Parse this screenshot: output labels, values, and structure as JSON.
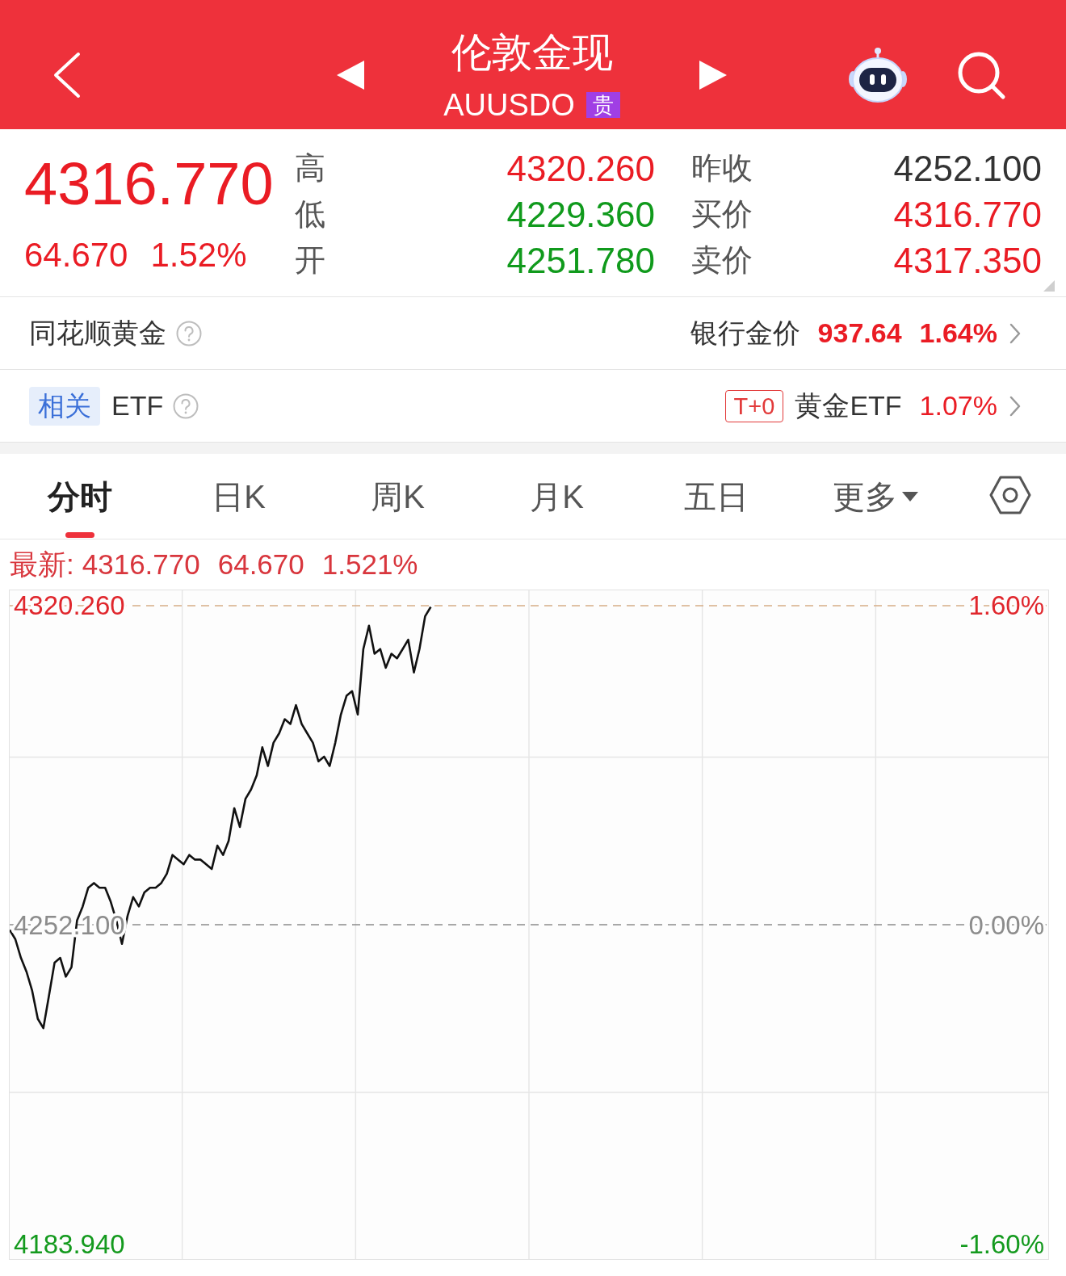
{
  "header": {
    "title": "伦敦金现",
    "code": "AUUSDO",
    "badge": "贵"
  },
  "quote": {
    "price": "4316.770",
    "change": "64.670",
    "percent": "1.52%",
    "color": "#ea1c24",
    "stats": [
      {
        "label": "高",
        "value": "4320.260",
        "color": "#ea1c24"
      },
      {
        "label": "低",
        "value": "4229.360",
        "color": "#109a1c"
      },
      {
        "label": "开",
        "value": "4251.780",
        "color": "#109a1c"
      }
    ],
    "stats_right": [
      {
        "label": "昨收",
        "value": "4252.100",
        "color": "#333333"
      },
      {
        "label": "买价",
        "value": "4316.770",
        "color": "#ea1c24"
      },
      {
        "label": "卖价",
        "value": "4317.350",
        "color": "#ea1c24"
      }
    ]
  },
  "links": [
    {
      "kind": "index",
      "title": "同花顺黄金",
      "right_label": "银行金价",
      "price": "937.64",
      "percent": "1.64%"
    },
    {
      "kind": "etf",
      "tag": "相关",
      "title": "ETF",
      "badge": "T+0",
      "right_label": "黄金ETF",
      "percent": "1.07%"
    }
  ],
  "tabs": [
    {
      "label": "分时",
      "selected": true,
      "dropdown": false
    },
    {
      "label": "日K",
      "selected": false,
      "dropdown": false
    },
    {
      "label": "周K",
      "selected": false,
      "dropdown": false
    },
    {
      "label": "月K",
      "selected": false,
      "dropdown": false
    },
    {
      "label": "五日",
      "selected": false,
      "dropdown": false
    },
    {
      "label": "更多",
      "selected": false,
      "dropdown": true
    }
  ],
  "chart": {
    "latest": {
      "label": "最新:",
      "price": "4316.770",
      "change": "64.670",
      "percent": "1.521%"
    },
    "chart_data": {
      "type": "line",
      "ylim": [
        4180.49,
        4323.71
      ],
      "y2lim": [
        -1.681,
        1.681
      ],
      "yticks": [
        {
          "value": 4320.26,
          "label": "4320.260"
        },
        {
          "value": 4252.1,
          "label": "4252.100"
        },
        {
          "value": 4183.94,
          "label": "4183.940"
        }
      ],
      "y2ticks": [
        {
          "value": 1.6,
          "label": "1.60%"
        },
        {
          "value": 0,
          "label": "0.00%"
        },
        {
          "value": -1.6,
          "label": "-1.60%"
        }
      ],
      "ref_lines": [
        {
          "axis": "y",
          "value": 4320.26
        },
        {
          "axis": "y",
          "value": 4252.1
        }
      ],
      "series": [
        {
          "color": "#111111",
          "values": [
            4251,
            4249,
            4245,
            4242,
            4238,
            4232,
            4230,
            4237,
            4244,
            4245,
            4241,
            4243,
            4253,
            4256,
            4260,
            4261,
            4260,
            4260,
            4257,
            4253,
            4248,
            4254,
            4258,
            4256,
            4259,
            4260,
            4260,
            4261,
            4263,
            4267,
            4266,
            4265,
            4267,
            4266,
            4266,
            4265,
            4264,
            4269,
            4267,
            4270,
            4277,
            4273,
            4279,
            4281,
            4284,
            4290,
            4286,
            4291,
            4293,
            4296,
            4295,
            4299,
            4295,
            4293,
            4291,
            4287,
            4288,
            4286,
            4291,
            4297,
            4301,
            4302,
            4297,
            4311,
            4316,
            4310,
            4311,
            4307,
            4310,
            4309,
            4311,
            4313,
            4306,
            4311,
            4318,
            4320,
            null,
            null,
            null,
            null,
            null,
            null,
            null,
            null,
            null,
            null,
            null,
            null,
            null,
            null,
            null,
            null,
            null,
            null,
            null,
            null,
            null,
            null,
            null,
            null,
            null,
            null,
            null,
            null,
            null,
            null,
            null,
            null,
            null,
            null,
            null,
            null,
            null,
            null,
            null,
            null,
            null,
            null,
            null,
            null,
            null,
            null,
            null,
            null,
            null,
            null,
            null,
            null,
            null,
            null,
            null,
            null,
            null,
            null,
            null,
            null,
            null,
            null,
            null,
            null,
            null,
            null,
            null,
            null,
            null,
            null,
            null,
            null,
            null,
            null,
            null,
            null,
            null,
            null,
            null,
            null,
            null,
            null,
            null,
            null,
            null,
            null,
            null,
            null,
            null,
            null,
            null,
            null,
            null,
            null,
            null,
            null,
            null,
            null,
            null,
            null,
            null,
            null,
            null,
            null,
            null,
            null,
            null,
            null,
            null,
            null
          ]
        }
      ]
    }
  }
}
